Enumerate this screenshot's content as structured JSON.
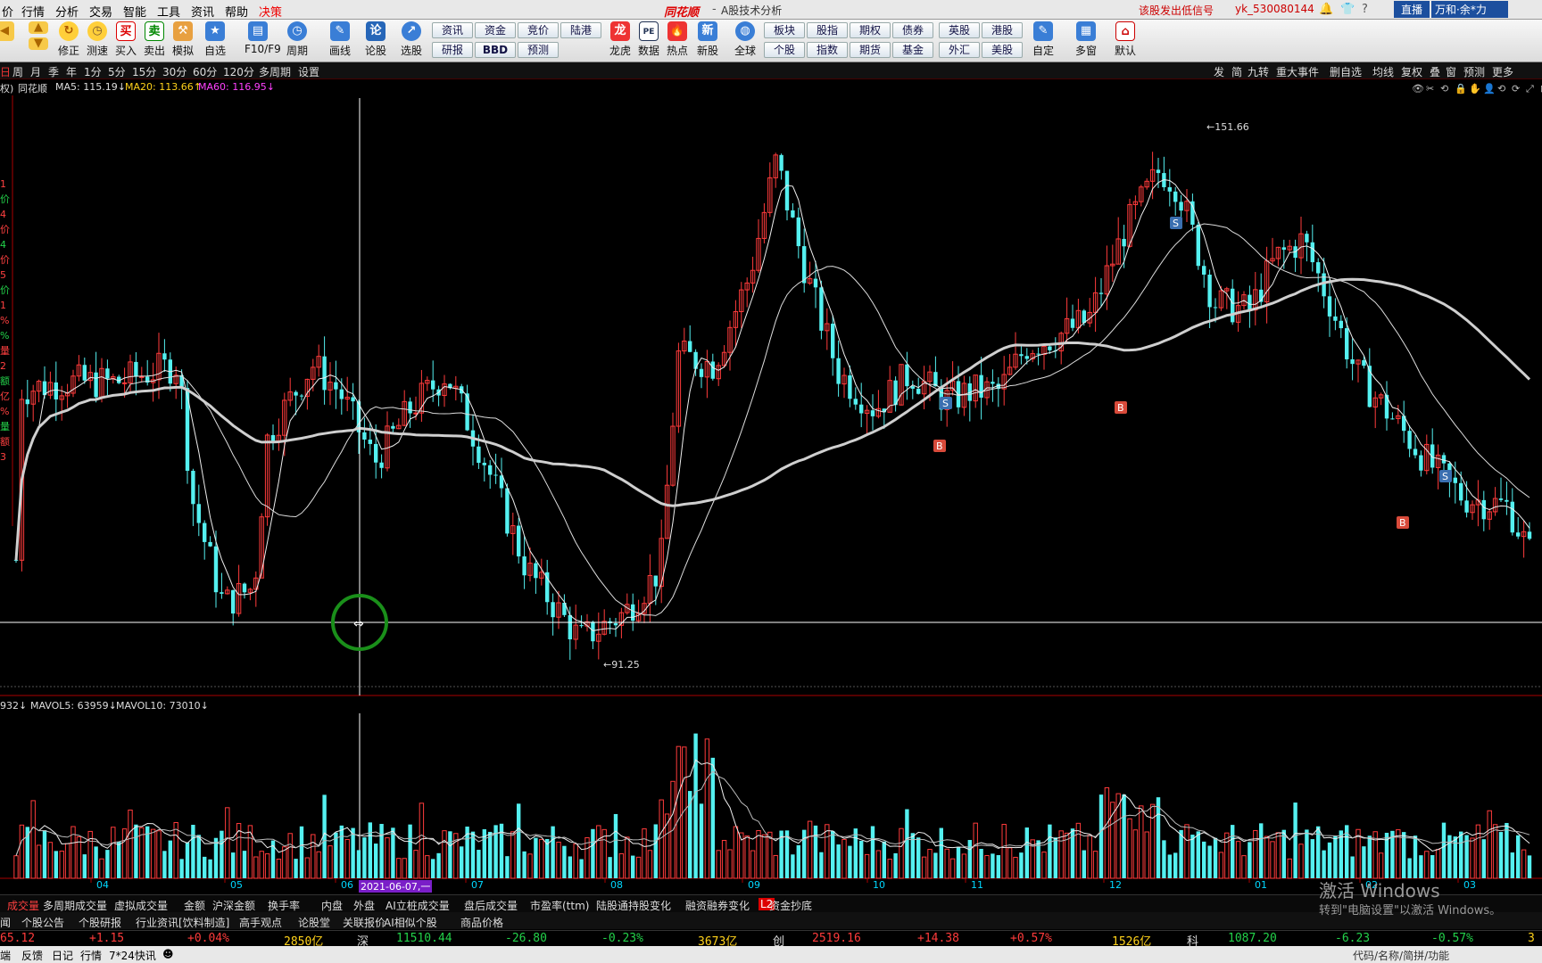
{
  "menubar": {
    "items": [
      "价",
      "行情",
      "分析",
      "交易",
      "智能",
      "工具",
      "资讯",
      "帮助",
      "决策"
    ],
    "logo": "同花顺",
    "subtitle": "A股技术分析",
    "signal": "该股发出低信号",
    "user": "yk_530080144",
    "live": "直播",
    "account": "万和·余*力"
  },
  "toolbar": {
    "left": [
      "修正",
      "测速",
      "买入",
      "卖出",
      "模拟",
      "自选",
      "F10/F9",
      "周期",
      "画线",
      "论股",
      "选股"
    ],
    "grid1": [
      "资讯",
      "资金",
      "竞价",
      "陆港",
      "研报",
      "BBD",
      "预测"
    ],
    "mid": [
      "龙虎",
      "数据",
      "热点",
      "新股",
      "全球"
    ],
    "grid2": [
      "板块",
      "股指",
      "期权",
      "债券",
      "英股",
      "港股",
      "个股",
      "指数",
      "期货",
      "基金",
      "外汇",
      "美股"
    ],
    "right": [
      "自定",
      "多窗",
      "默认"
    ]
  },
  "periods": [
    "周",
    "月",
    "季",
    "年",
    "1分",
    "5分",
    "15分",
    "30分",
    "60分",
    "120分",
    "多周期",
    "设置"
  ],
  "rightTools": [
    "发",
    "简",
    "九转",
    "重大事件",
    "删自选",
    "均线",
    "复权",
    "叠",
    "窗",
    "预测",
    "更多"
  ],
  "info": {
    "name": "同花顺",
    "ma5": "MA5: 115.19↓",
    "ma20": "MA20: 113.66↑",
    "ma60": "MA60: 116.95↓"
  },
  "vol": {
    "vol": "932↓",
    "mavol5": "MAVOL5: 63959↓",
    "mavol10": "MAVOL10: 73010↓"
  },
  "leftLabels": [
    "1",
    "价",
    "4",
    "价",
    "4",
    "价",
    "5",
    "价",
    "1",
    "%",
    "%",
    "量",
    "2",
    "额",
    "亿",
    "%",
    "量",
    "额",
    "3"
  ],
  "chart_data": {
    "type": "candlestick",
    "high_label": "151.66",
    "low_label": "91.25",
    "months": [
      "04",
      "05",
      "06",
      "07",
      "08",
      "09",
      "10",
      "11",
      "12",
      "01",
      "02",
      "03"
    ],
    "crosshair_date": "2021-06-07,一",
    "signals": [
      {
        "tag": "S",
        "at": "12",
        "level": "119"
      },
      {
        "tag": "B",
        "at": "01",
        "level": "108"
      }
    ]
  },
  "tabs1": [
    "成交量",
    "多周期成交量",
    "虚拟成交量",
    "金额",
    "沪深金额",
    "换手率",
    "内盘",
    "外盘",
    "AI立桩成交量",
    "盘后成交量",
    "市盈率(ttm)",
    "陆股通持股变化",
    "融资融券变化",
    "L2",
    "资金抄底"
  ],
  "tabs2": [
    "闻",
    "个股公告",
    "个股研报",
    "行业资讯[饮料制造]",
    "高手观点",
    "论股堂",
    "关联报价",
    "AI相似个股",
    "商品价格"
  ],
  "quote": {
    "v1": "65.12",
    "c1": "+1.15",
    "p1": "+0.04%",
    "a1": "2850亿",
    "n2": "深",
    "v2": "11510.44",
    "c2": "-26.80",
    "p2": "-0.23%",
    "a2": "3673亿",
    "n3": "创",
    "v3": "2519.16",
    "c3": "+14.38",
    "p3": "+0.57%",
    "a3": "1526亿",
    "n4": "科",
    "v4": "1087.20",
    "c4": "-6.23",
    "p4": "-0.57%",
    "a4": "3"
  },
  "bottom": [
    "端",
    "反馈",
    "日记",
    "行情",
    "7*24快讯",
    "代码/名称/简拼/功能"
  ],
  "watermark": {
    "l1": "激活 Windows",
    "l2": "转到\"电脑设置\"以激活 Windows。"
  }
}
